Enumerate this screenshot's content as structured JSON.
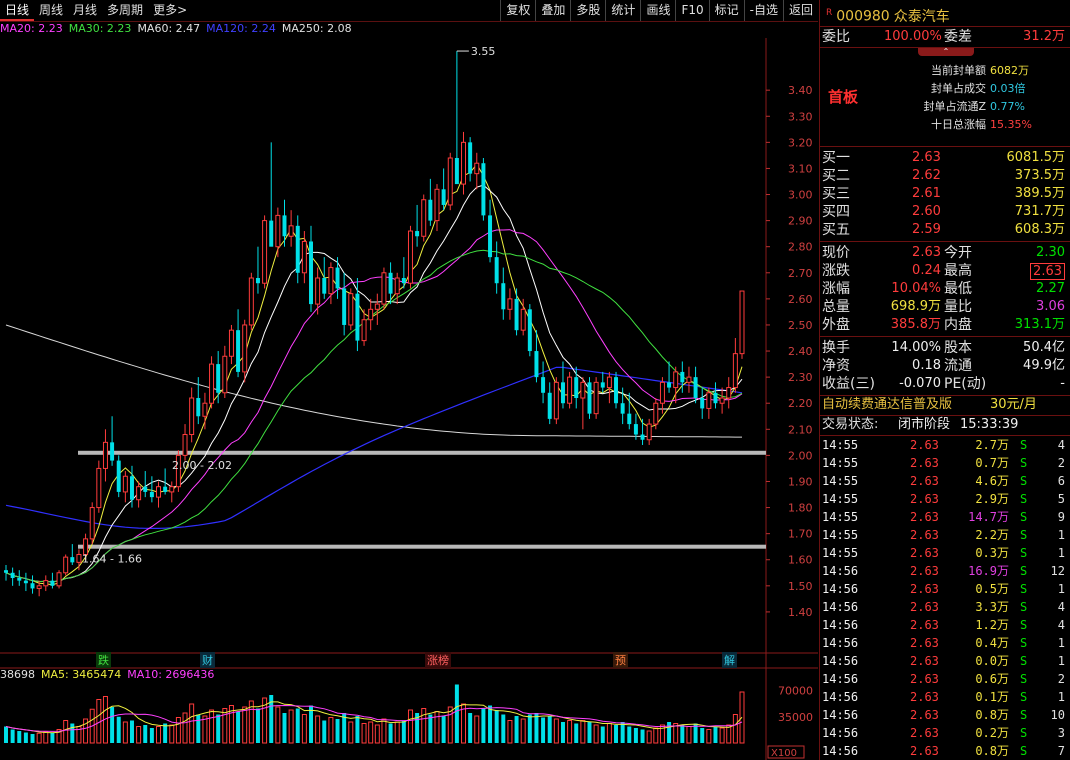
{
  "toolbar": {
    "periods": [
      "日线",
      "周线",
      "月线",
      "多周期",
      "更多>"
    ],
    "tools": [
      "复权",
      "叠加",
      "多股",
      "统计",
      "画线",
      "F10",
      "标记",
      "-自选",
      "返回"
    ]
  },
  "ma_legend": [
    {
      "text": "MA20: 2.23",
      "color": "#ff40ff"
    },
    {
      "text": "MA30: 2.23",
      "color": "#40e040"
    },
    {
      "text": "MA60: 2.47",
      "color": "#e0e0e0"
    },
    {
      "text": "MA120: 2.24",
      "color": "#4040ff"
    },
    {
      "text": "MA250: 2.08",
      "color": "#e0e0e0"
    }
  ],
  "vol_legend": [
    {
      "text": "38698",
      "color": "#e0e0e0"
    },
    {
      "text": "MA5: 3465474",
      "color": "#f0f040"
    },
    {
      "text": "MA10: 2696436",
      "color": "#ff40ff"
    }
  ],
  "events": [
    {
      "text": "跌",
      "color": "#40e040",
      "bg": "#0a3a0a"
    },
    {
      "text": "财",
      "color": "#30c8e0",
      "bg": "#0a2a3a"
    },
    {
      "text": "涨榜",
      "color": "#ff6060",
      "bg": "#3a0a0a"
    },
    {
      "text": "预",
      "color": "#ff8040",
      "bg": "#3a1a0a"
    },
    {
      "text": "解",
      "color": "#30c8e0",
      "bg": "#0a2a3a"
    }
  ],
  "chart_data": {
    "type": "candlestick",
    "y_ticks": [
      "3.40",
      "3.30",
      "3.20",
      "3.10",
      "3.00",
      "2.90",
      "2.80",
      "2.70",
      "2.60",
      "2.50",
      "2.40",
      "2.30",
      "2.20",
      "2.10",
      "2.00",
      "1.90",
      "1.80",
      "1.70",
      "1.60",
      "1.50",
      "1.40"
    ],
    "ylim": [
      1.3,
      3.6
    ],
    "annotations": [
      "3.55",
      "2.00 - 2.02",
      "1.64 - 1.66"
    ],
    "support_bands": [
      2.01,
      1.65
    ],
    "vol_ticks": [
      "70000",
      "35000"
    ],
    "vol_unit": "X100",
    "last_close": 2.63,
    "candles": [
      [
        1.56,
        1.58,
        1.52,
        1.55
      ],
      [
        1.55,
        1.57,
        1.5,
        1.53
      ],
      [
        1.53,
        1.56,
        1.5,
        1.52
      ],
      [
        1.52,
        1.55,
        1.48,
        1.51
      ],
      [
        1.51,
        1.54,
        1.47,
        1.49
      ],
      [
        1.49,
        1.52,
        1.46,
        1.5
      ],
      [
        1.5,
        1.54,
        1.48,
        1.52
      ],
      [
        1.52,
        1.55,
        1.49,
        1.5
      ],
      [
        1.5,
        1.56,
        1.49,
        1.55
      ],
      [
        1.55,
        1.62,
        1.54,
        1.61
      ],
      [
        1.61,
        1.66,
        1.58,
        1.59
      ],
      [
        1.59,
        1.64,
        1.56,
        1.62
      ],
      [
        1.62,
        1.7,
        1.6,
        1.68
      ],
      [
        1.68,
        1.82,
        1.66,
        1.8
      ],
      [
        1.8,
        1.98,
        1.78,
        1.95
      ],
      [
        1.95,
        2.1,
        1.9,
        2.05
      ],
      [
        2.05,
        2.15,
        1.96,
        1.98
      ],
      [
        1.98,
        2.0,
        1.84,
        1.86
      ],
      [
        1.86,
        1.94,
        1.82,
        1.92
      ],
      [
        1.92,
        1.96,
        1.8,
        1.83
      ],
      [
        1.83,
        1.9,
        1.8,
        1.88
      ],
      [
        1.88,
        1.94,
        1.84,
        1.86
      ],
      [
        1.86,
        1.92,
        1.82,
        1.84
      ],
      [
        1.84,
        1.9,
        1.8,
        1.88
      ],
      [
        1.88,
        1.95,
        1.85,
        1.86
      ],
      [
        1.86,
        1.9,
        1.82,
        1.88
      ],
      [
        1.88,
        2.02,
        1.86,
        2.0
      ],
      [
        2.0,
        2.12,
        1.98,
        2.08
      ],
      [
        2.08,
        2.26,
        2.05,
        2.22
      ],
      [
        2.22,
        2.3,
        2.12,
        2.15
      ],
      [
        2.15,
        2.24,
        2.1,
        2.2
      ],
      [
        2.2,
        2.38,
        2.18,
        2.35
      ],
      [
        2.35,
        2.4,
        2.2,
        2.24
      ],
      [
        2.24,
        2.42,
        2.22,
        2.38
      ],
      [
        2.38,
        2.5,
        2.35,
        2.48
      ],
      [
        2.48,
        2.56,
        2.3,
        2.32
      ],
      [
        2.32,
        2.52,
        2.28,
        2.5
      ],
      [
        2.5,
        2.7,
        2.48,
        2.68
      ],
      [
        2.68,
        2.8,
        2.62,
        2.66
      ],
      [
        2.66,
        2.92,
        2.64,
        2.9
      ],
      [
        2.9,
        3.2,
        2.86,
        2.8
      ],
      [
        2.8,
        2.95,
        2.76,
        2.92
      ],
      [
        2.92,
        2.98,
        2.8,
        2.84
      ],
      [
        2.84,
        2.94,
        2.8,
        2.88
      ],
      [
        2.88,
        2.92,
        2.66,
        2.7
      ],
      [
        2.7,
        2.86,
        2.66,
        2.82
      ],
      [
        2.82,
        2.88,
        2.55,
        2.58
      ],
      [
        2.58,
        2.72,
        2.54,
        2.68
      ],
      [
        2.68,
        2.76,
        2.6,
        2.62
      ],
      [
        2.62,
        2.74,
        2.58,
        2.72
      ],
      [
        2.72,
        2.76,
        2.6,
        2.64
      ],
      [
        2.64,
        2.7,
        2.46,
        2.5
      ],
      [
        2.5,
        2.64,
        2.48,
        2.62
      ],
      [
        2.62,
        2.68,
        2.4,
        2.44
      ],
      [
        2.44,
        2.56,
        2.42,
        2.52
      ],
      [
        2.52,
        2.6,
        2.48,
        2.56
      ],
      [
        2.56,
        2.62,
        2.5,
        2.58
      ],
      [
        2.58,
        2.72,
        2.56,
        2.7
      ],
      [
        2.7,
        2.74,
        2.58,
        2.62
      ],
      [
        2.62,
        2.7,
        2.58,
        2.68
      ],
      [
        2.68,
        2.76,
        2.64,
        2.66
      ],
      [
        2.66,
        2.88,
        2.64,
        2.86
      ],
      [
        2.86,
        2.96,
        2.8,
        2.84
      ],
      [
        2.84,
        3.0,
        2.82,
        2.98
      ],
      [
        2.98,
        3.06,
        2.88,
        2.9
      ],
      [
        2.9,
        3.04,
        2.86,
        3.02
      ],
      [
        3.02,
        3.1,
        2.94,
        2.96
      ],
      [
        2.96,
        3.16,
        2.94,
        3.14
      ],
      [
        3.14,
        3.55,
        3.1,
        3.04
      ],
      [
        3.04,
        3.24,
        3.0,
        3.2
      ],
      [
        3.2,
        3.22,
        3.05,
        3.08
      ],
      [
        3.08,
        3.16,
        3.02,
        3.12
      ],
      [
        3.12,
        3.14,
        2.9,
        2.92
      ],
      [
        2.92,
        2.98,
        2.74,
        2.76
      ],
      [
        2.76,
        2.82,
        2.62,
        2.66
      ],
      [
        2.66,
        2.72,
        2.52,
        2.56
      ],
      [
        2.56,
        2.64,
        2.52,
        2.6
      ],
      [
        2.6,
        2.64,
        2.46,
        2.48
      ],
      [
        2.48,
        2.6,
        2.46,
        2.56
      ],
      [
        2.56,
        2.58,
        2.38,
        2.4
      ],
      [
        2.4,
        2.48,
        2.28,
        2.3
      ],
      [
        2.3,
        2.36,
        2.2,
        2.24
      ],
      [
        2.24,
        2.28,
        2.12,
        2.14
      ],
      [
        2.14,
        2.3,
        2.12,
        2.28
      ],
      [
        2.28,
        2.36,
        2.18,
        2.2
      ],
      [
        2.2,
        2.32,
        2.18,
        2.3
      ],
      [
        2.3,
        2.34,
        2.18,
        2.22
      ],
      [
        2.22,
        2.3,
        2.1,
        2.28
      ],
      [
        2.28,
        2.3,
        2.14,
        2.16
      ],
      [
        2.16,
        2.3,
        2.14,
        2.28
      ],
      [
        2.28,
        2.32,
        2.24,
        2.26
      ],
      [
        2.26,
        2.32,
        2.2,
        2.3
      ],
      [
        2.3,
        2.32,
        2.18,
        2.2
      ],
      [
        2.2,
        2.26,
        2.12,
        2.16
      ],
      [
        2.16,
        2.24,
        2.1,
        2.12
      ],
      [
        2.12,
        2.16,
        2.06,
        2.08
      ],
      [
        2.08,
        2.14,
        2.04,
        2.06
      ],
      [
        2.06,
        2.14,
        2.04,
        2.12
      ],
      [
        2.12,
        2.22,
        2.1,
        2.2
      ],
      [
        2.2,
        2.3,
        2.16,
        2.28
      ],
      [
        2.28,
        2.36,
        2.24,
        2.26
      ],
      [
        2.26,
        2.34,
        2.2,
        2.32
      ],
      [
        2.32,
        2.36,
        2.24,
        2.28
      ],
      [
        2.28,
        2.34,
        2.24,
        2.3
      ],
      [
        2.3,
        2.34,
        2.2,
        2.22
      ],
      [
        2.22,
        2.26,
        2.14,
        2.18
      ],
      [
        2.18,
        2.26,
        2.14,
        2.24
      ],
      [
        2.24,
        2.28,
        2.18,
        2.2
      ],
      [
        2.2,
        2.26,
        2.16,
        2.22
      ],
      [
        2.22,
        2.3,
        2.18,
        2.26
      ],
      [
        2.26,
        2.45,
        2.24,
        2.39
      ],
      [
        2.39,
        2.63,
        2.37,
        2.63
      ]
    ],
    "volumes": [
      22,
      18,
      16,
      14,
      12,
      13,
      15,
      14,
      18,
      30,
      26,
      22,
      32,
      45,
      58,
      62,
      48,
      35,
      28,
      30,
      22,
      24,
      20,
      22,
      26,
      24,
      34,
      40,
      52,
      38,
      36,
      44,
      38,
      46,
      50,
      42,
      48,
      56,
      46,
      60,
      64,
      48,
      40,
      44,
      46,
      38,
      50,
      36,
      30,
      34,
      32,
      40,
      28,
      36,
      26,
      28,
      24,
      32,
      26,
      28,
      30,
      44,
      40,
      46,
      38,
      42,
      36,
      48,
      78,
      52,
      40,
      36,
      46,
      50,
      44,
      38,
      30,
      36,
      32,
      38,
      40,
      34,
      36,
      32,
      28,
      30,
      26,
      30,
      28,
      24,
      22,
      26,
      24,
      28,
      22,
      20,
      18,
      16,
      20,
      24,
      28,
      26,
      24,
      22,
      26,
      20,
      18,
      22,
      20,
      24,
      38,
      68
    ],
    "ma_lines": [
      {
        "name": "MA5",
        "color": "#f0f040",
        "period": 5
      },
      {
        "name": "MA10",
        "color": "#ffffff",
        "period": 10
      },
      {
        "name": "MA20",
        "color": "#ff40ff",
        "period": 20
      },
      {
        "name": "MA30",
        "color": "#40e040",
        "period": 30
      }
    ],
    "ma120_color": "#3030ff",
    "ma250_color": "#d8d8d8"
  },
  "panel": {
    "code": "000980",
    "name": "众泰汽车",
    "r_badge": "R",
    "weibi_label": "委比",
    "weibi": "100.00%",
    "weicha_label": "委差",
    "weicha": "31.2万",
    "shouban": "首板",
    "seal_info": [
      {
        "label": "当前封单额",
        "value": "6082万",
        "color": "#f0e040"
      },
      {
        "label": "封单占成交",
        "value": "0.03倍",
        "color": "#30c8e0"
      },
      {
        "label": "封单占流通Z",
        "value": "0.77%",
        "color": "#30c8e0"
      },
      {
        "label": "十日总涨幅",
        "value": "15.35%",
        "color": "#ff4040"
      }
    ],
    "bids": [
      {
        "label": "买一",
        "price": "2.63",
        "vol": "6081.5万"
      },
      {
        "label": "买二",
        "price": "2.62",
        "vol": "373.5万"
      },
      {
        "label": "买三",
        "price": "2.61",
        "vol": "389.5万"
      },
      {
        "label": "买四",
        "price": "2.60",
        "vol": "731.7万"
      },
      {
        "label": "买五",
        "price": "2.59",
        "vol": "608.3万"
      }
    ],
    "quote": [
      {
        "l1": "现价",
        "v1": "2.63",
        "c1": "red",
        "l2": "今开",
        "v2": "2.30",
        "c2": "green"
      },
      {
        "l1": "涨跌",
        "v1": "0.24",
        "c1": "red",
        "l2": "最高",
        "v2": "2.63",
        "c2": "red",
        "box2": true
      },
      {
        "l1": "涨幅",
        "v1": "10.04%",
        "c1": "red",
        "l2": "最低",
        "v2": "2.27",
        "c2": "green"
      },
      {
        "l1": "总量",
        "v1": "698.9万",
        "c1": "yellow",
        "l2": "量比",
        "v2": "3.06",
        "c2": "mag"
      },
      {
        "l1": "外盘",
        "v1": "385.8万",
        "c1": "red",
        "l2": "内盘",
        "v2": "313.1万",
        "c2": "green"
      }
    ],
    "fin": [
      {
        "l1": "换手",
        "v1": "14.00%",
        "l2": "股本",
        "v2": "50.4亿"
      },
      {
        "l1": "净资",
        "v1": "0.18",
        "l2": "流通",
        "v2": "49.9亿"
      },
      {
        "l1": "收益(三)",
        "v1": "-0.070",
        "l2": "PE(动)",
        "v2": "-"
      }
    ],
    "ad_text": "自动续费通达信普及版",
    "ad_price": "30元/月",
    "status_label": "交易状态:",
    "status_value": "闭市阶段",
    "status_time": "15:33:39",
    "ticks": [
      {
        "t": "14:55",
        "p": "2.63",
        "v": "2.7万",
        "vc": "yellow",
        "n": "4"
      },
      {
        "t": "14:55",
        "p": "2.63",
        "v": "0.7万",
        "vc": "yellow",
        "n": "2"
      },
      {
        "t": "14:55",
        "p": "2.63",
        "v": "4.6万",
        "vc": "yellow",
        "n": "6"
      },
      {
        "t": "14:55",
        "p": "2.63",
        "v": "2.9万",
        "vc": "yellow",
        "n": "5"
      },
      {
        "t": "14:55",
        "p": "2.63",
        "v": "14.7万",
        "vc": "mag",
        "n": "9"
      },
      {
        "t": "14:55",
        "p": "2.63",
        "v": "2.2万",
        "vc": "yellow",
        "n": "1"
      },
      {
        "t": "14:55",
        "p": "2.63",
        "v": "0.3万",
        "vc": "yellow",
        "n": "1"
      },
      {
        "t": "14:56",
        "p": "2.63",
        "v": "16.9万",
        "vc": "mag",
        "n": "12"
      },
      {
        "t": "14:56",
        "p": "2.63",
        "v": "0.5万",
        "vc": "yellow",
        "n": "1"
      },
      {
        "t": "14:56",
        "p": "2.63",
        "v": "3.3万",
        "vc": "yellow",
        "n": "4"
      },
      {
        "t": "14:56",
        "p": "2.63",
        "v": "1.2万",
        "vc": "yellow",
        "n": "4"
      },
      {
        "t": "14:56",
        "p": "2.63",
        "v": "0.4万",
        "vc": "yellow",
        "n": "1"
      },
      {
        "t": "14:56",
        "p": "2.63",
        "v": "0.0万",
        "vc": "yellow",
        "n": "1"
      },
      {
        "t": "14:56",
        "p": "2.63",
        "v": "0.6万",
        "vc": "yellow",
        "n": "2"
      },
      {
        "t": "14:56",
        "p": "2.63",
        "v": "0.1万",
        "vc": "yellow",
        "n": "1"
      },
      {
        "t": "14:56",
        "p": "2.63",
        "v": "0.8万",
        "vc": "yellow",
        "n": "10"
      },
      {
        "t": "14:56",
        "p": "2.63",
        "v": "0.2万",
        "vc": "yellow",
        "n": "3"
      },
      {
        "t": "14:56",
        "p": "2.63",
        "v": "0.8万",
        "vc": "yellow",
        "n": "7"
      }
    ],
    "tick_side": "S"
  }
}
